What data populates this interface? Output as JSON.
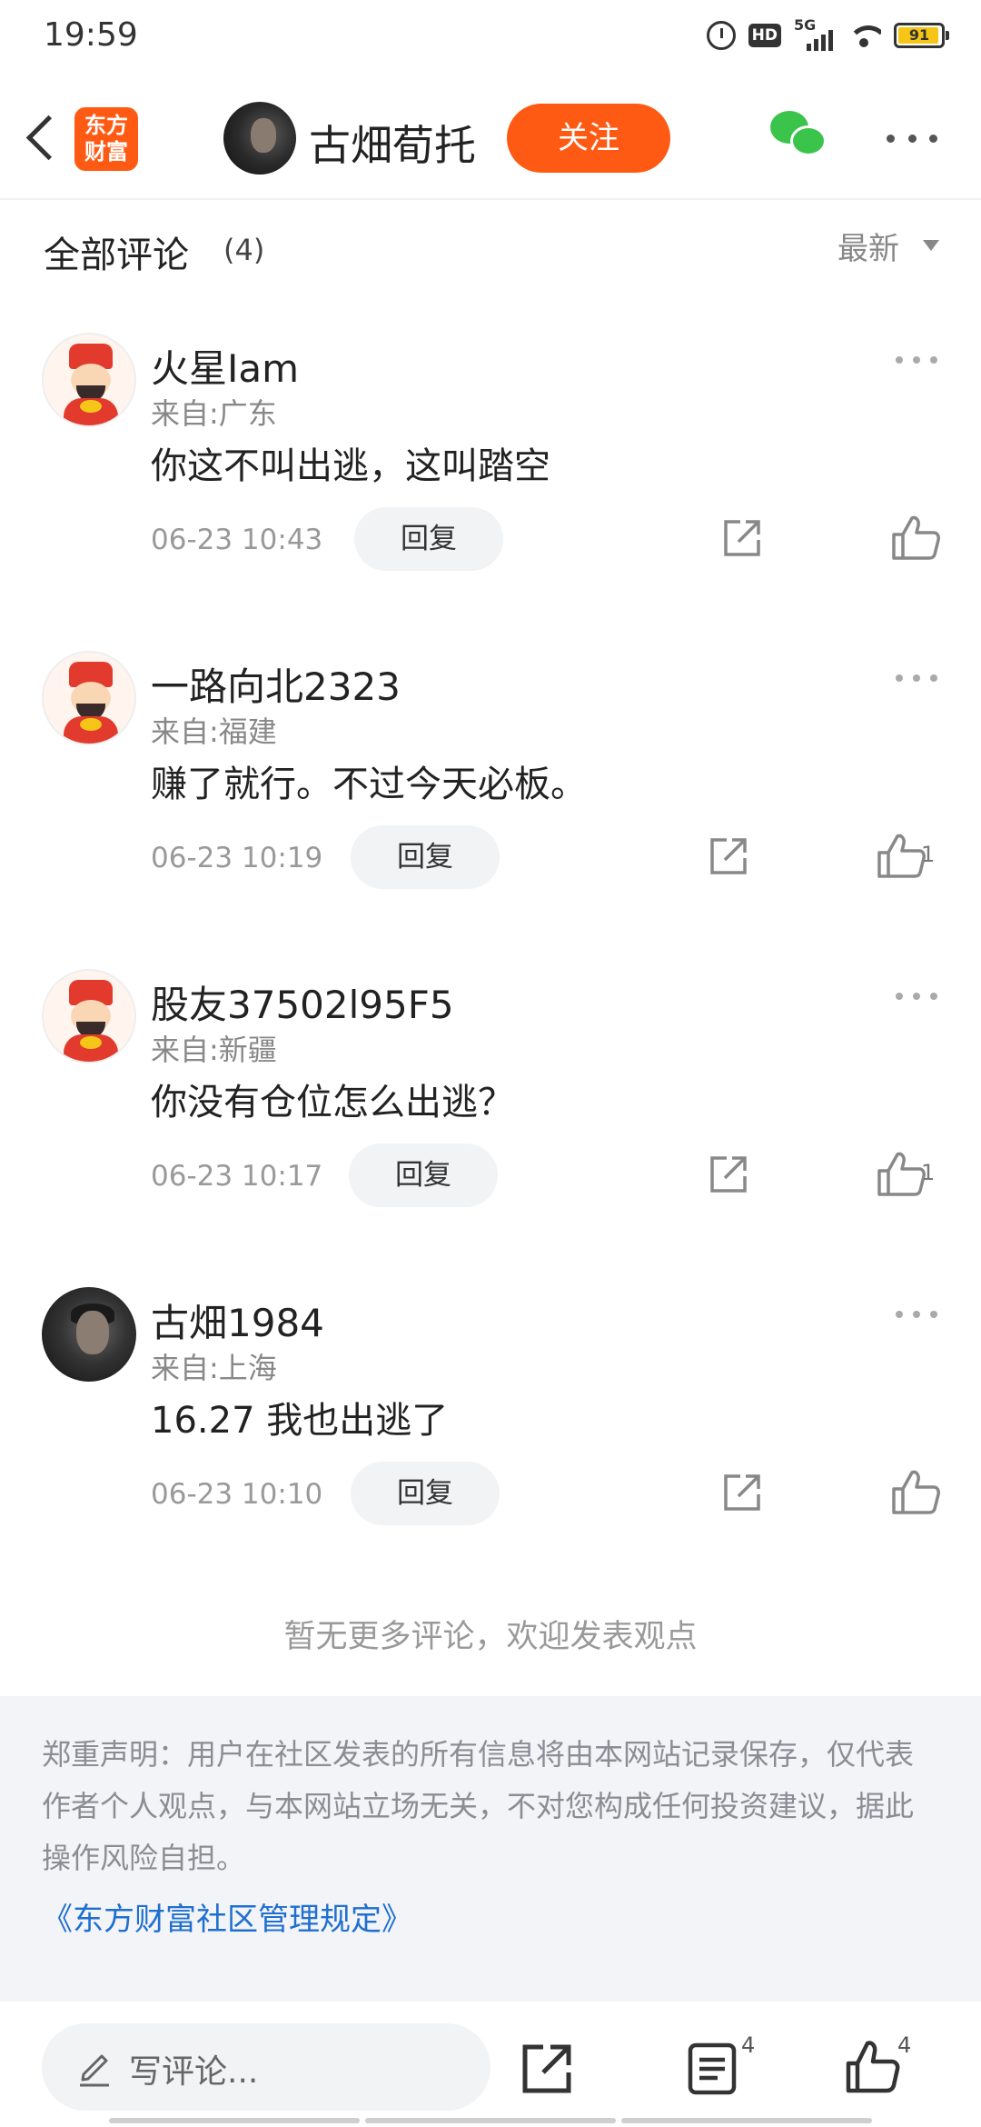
{
  "status_bar": {
    "time": "19:59",
    "hd_label": "HD",
    "network_label": "5G",
    "battery_level": "91"
  },
  "header": {
    "logo_line1": "东方",
    "logo_line2": "财富",
    "author_name": "古畑荀托",
    "follow_label": "关注"
  },
  "comments_section": {
    "title": "全部评论",
    "count": "(4)",
    "sort_label": "最新"
  },
  "comments": [
    {
      "name": "火星Iam",
      "location": "来自:广东",
      "text": "你这不叫出逃，这叫踏空",
      "time": "06-23 10:43",
      "reply_label": "回复",
      "likes": "",
      "avatar": "caishen-avatar"
    },
    {
      "name": "一路向北2323",
      "location": "来自:福建",
      "text": "赚了就行。不过今天必板。",
      "time": "06-23 10:19",
      "reply_label": "回复",
      "likes": "1",
      "avatar": "caishen-avatar"
    },
    {
      "name": "股友37502l95F5",
      "location": "来自:新疆",
      "text": "你没有仓位怎么出逃？",
      "time": "06-23 10:17",
      "reply_label": "回复",
      "likes": "1",
      "avatar": "caishen-avatar"
    },
    {
      "name": "古畑1984",
      "location": "来自:上海",
      "text": "16.27 我也出逃了",
      "time": "06-23 10:10",
      "reply_label": "回复",
      "likes": "",
      "avatar": "photo-avatar"
    }
  ],
  "end_message": "暂无更多评论，欢迎发表观点",
  "disclaimer": {
    "text": "郑重声明：用户在社区发表的所有信息将由本网站记录保存，仅代表作者个人观点，与本网站立场无关，不对您构成任何投资建议，据此操作风险自担。",
    "link_label": "《东方财富社区管理规定》"
  },
  "bottom_bar": {
    "input_placeholder": "写评论...",
    "comments_count": "4",
    "likes_count": "4"
  },
  "colors": {
    "brand_orange": "#ff5a14",
    "wechat_green": "#3bc44b",
    "link_blue": "#1f6fd1"
  }
}
